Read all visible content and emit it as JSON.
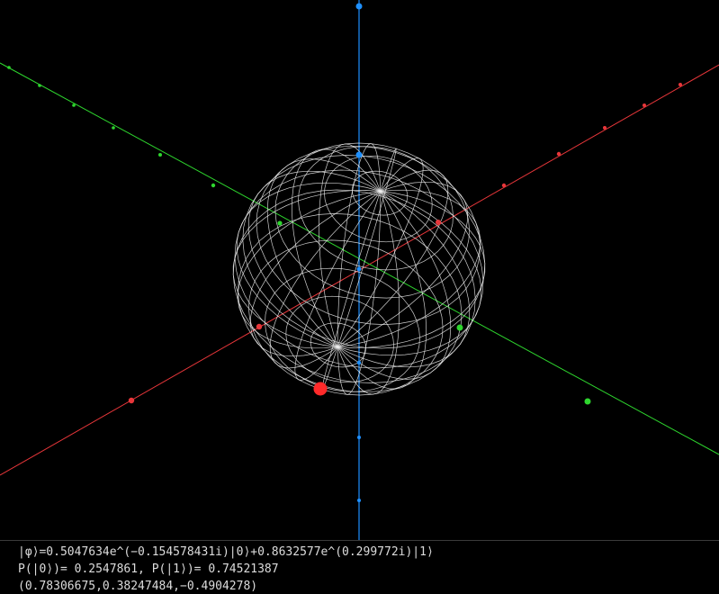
{
  "colors": {
    "background": "#000000",
    "x_axis": "#e8363a",
    "y_axis": "#2ed62e",
    "z_axis": "#1e90ff",
    "sphere_wireframe": "#f2f2f2",
    "state_marker": "#ff2a2a",
    "text": "#dcdcdc"
  },
  "scene": {
    "type": "bloch-sphere-wireframe",
    "state_vector": [
      0.78306675,
      0.38247484,
      -0.4904278
    ]
  },
  "info": {
    "state_line": "|φ⟩=0.5047634e^(−0.154578431i)|0⟩+0.8632577e^(0.299772i)|1⟩",
    "probability_line": "P(|0⟩)= 0.2547861, P(|1⟩)= 0.74521387",
    "vector_line": "(0.78306675,0.38247484,−0.4904278)"
  }
}
